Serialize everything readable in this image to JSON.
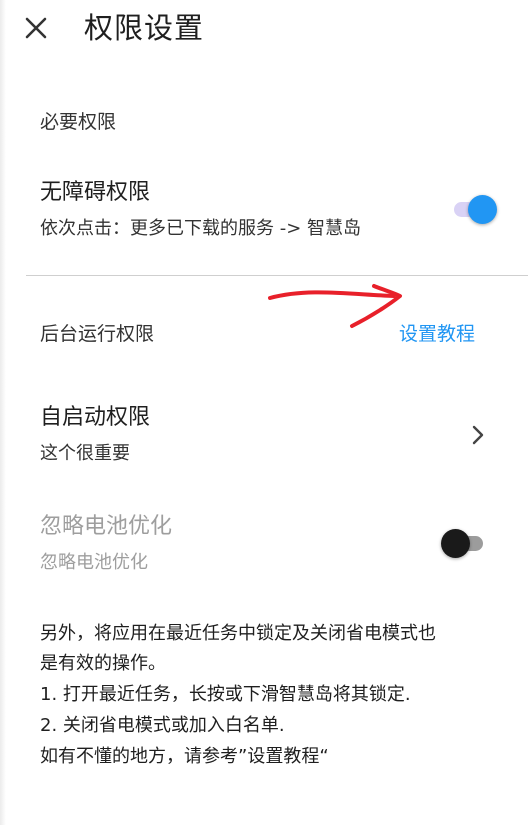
{
  "header": {
    "title": "权限设置",
    "close_icon": "close-icon"
  },
  "required_section": {
    "header": "必要权限",
    "accessibility": {
      "title": "无障碍权限",
      "subtitle": "依次点击：更多已下载的服务 -> 智慧岛",
      "enabled": true
    }
  },
  "background_section": {
    "header": "后台运行权限",
    "tutorial_link": "设置教程",
    "autostart": {
      "title": "自启动权限",
      "subtitle": "这个很重要",
      "icon": "chevron-right-icon"
    },
    "battery": {
      "title": "忽略电池优化",
      "subtitle": "忽略电池优化",
      "enabled": false,
      "disabled_appearance": true
    }
  },
  "notes": {
    "line1": "另外，将应用在最近任务中锁定及关闭省电模式也",
    "line2": "是有效的操作。",
    "line3": "1. 打开最近任务，长按或下滑智慧岛将其锁定.",
    "line4": "2. 关闭省电模式或加入白名单.",
    "line5": "如有不懂的地方，请参考”设置教程“"
  },
  "colors": {
    "accent": "#2196f3",
    "annotation_arrow": "#e8202a",
    "disabled_text": "#9e9e9e"
  }
}
